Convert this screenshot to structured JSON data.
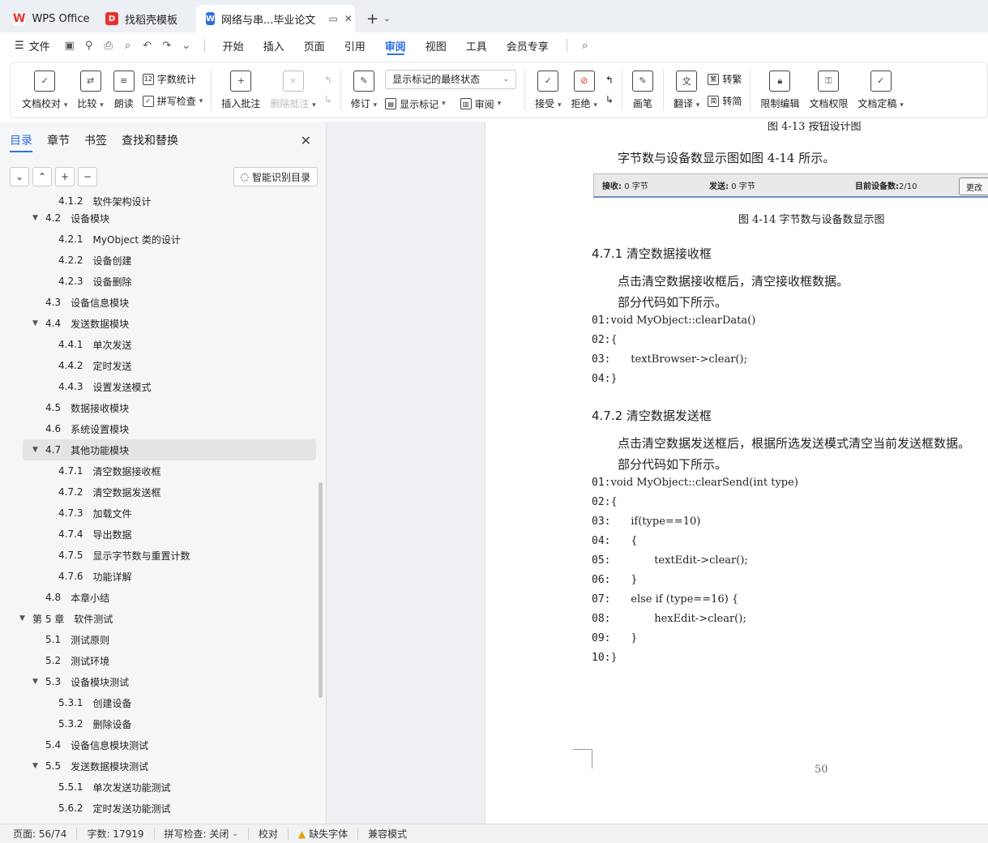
{
  "tabs": [
    {
      "label": "WPS Office"
    },
    {
      "label": "找稻壳模板"
    },
    {
      "label": "网络与串...毕业论文"
    }
  ],
  "menubar": {
    "file": "文件",
    "items": [
      "开始",
      "插入",
      "页面",
      "引用",
      "审阅",
      "视图",
      "工具",
      "会员专享"
    ],
    "active": "审阅"
  },
  "ribbon": {
    "doc_proof": "文档校对",
    "compare": "比较",
    "read_aloud": "朗读",
    "word_count": "字数统计",
    "spell_check": "拼写检查",
    "insert_comment": "插入批注",
    "delete_comment": "删除批注",
    "revise": "修订",
    "markup_state": "显示标记的最终状态",
    "show_markup": "显示标记",
    "review": "审阅",
    "accept": "接受",
    "reject": "拒绝",
    "pen": "画笔",
    "translate": "翻译",
    "to_traditional": "转繁",
    "to_simplified": "转简",
    "restrict_edit": "限制编辑",
    "doc_permission": "文档权限",
    "finalize": "文档定稿"
  },
  "panel": {
    "tabs": [
      "目录",
      "章节",
      "书签",
      "查找和替换"
    ],
    "smart_toc": "智能识别目录",
    "toc": [
      {
        "num": "4.1.2",
        "label": "软件架构设计",
        "level": 3,
        "arrow": ""
      },
      {
        "num": "4.2",
        "label": "设备模块",
        "level": 2,
        "arrow": "▼"
      },
      {
        "num": "4.2.1",
        "label": "MyObject 类的设计",
        "level": 3,
        "arrow": ""
      },
      {
        "num": "4.2.2",
        "label": "设备创建",
        "level": 3,
        "arrow": ""
      },
      {
        "num": "4.2.3",
        "label": "设备删除",
        "level": 3,
        "arrow": ""
      },
      {
        "num": "4.3",
        "label": "设备信息模块",
        "level": 2,
        "arrow": ""
      },
      {
        "num": "4.4",
        "label": "发送数据模块",
        "level": 2,
        "arrow": "▼"
      },
      {
        "num": "4.4.1",
        "label": "单次发送",
        "level": 3,
        "arrow": ""
      },
      {
        "num": "4.4.2",
        "label": "定时发送",
        "level": 3,
        "arrow": ""
      },
      {
        "num": "4.4.3",
        "label": "设置发送模式",
        "level": 3,
        "arrow": ""
      },
      {
        "num": "4.5",
        "label": "数据接收模块",
        "level": 2,
        "arrow": ""
      },
      {
        "num": "4.6",
        "label": "系统设置模块",
        "level": 2,
        "arrow": ""
      },
      {
        "num": "4.7",
        "label": "其他功能模块",
        "level": 2,
        "arrow": "▼",
        "selected": true
      },
      {
        "num": "4.7.1",
        "label": "清空数据接收框",
        "level": 3,
        "arrow": ""
      },
      {
        "num": "4.7.2",
        "label": "清空数据发送框",
        "level": 3,
        "arrow": ""
      },
      {
        "num": "4.7.3",
        "label": "加载文件",
        "level": 3,
        "arrow": ""
      },
      {
        "num": "4.7.4",
        "label": "导出数据",
        "level": 3,
        "arrow": ""
      },
      {
        "num": "4.7.5",
        "label": "显示字节数与重置计数",
        "level": 3,
        "arrow": ""
      },
      {
        "num": "4.7.6",
        "label": "功能详解",
        "level": 3,
        "arrow": ""
      },
      {
        "num": "4.8",
        "label": "本章小结",
        "level": 2,
        "arrow": ""
      },
      {
        "num": "第 5 章",
        "label": "软件测试",
        "level": 1,
        "arrow": "▼"
      },
      {
        "num": "5.1",
        "label": "测试原则",
        "level": 2,
        "arrow": ""
      },
      {
        "num": "5.2",
        "label": "测试环境",
        "level": 2,
        "arrow": ""
      },
      {
        "num": "5.3",
        "label": "设备模块测试",
        "level": 2,
        "arrow": "▼"
      },
      {
        "num": "5.3.1",
        "label": "创建设备",
        "level": 3,
        "arrow": ""
      },
      {
        "num": "5.3.2",
        "label": "删除设备",
        "level": 3,
        "arrow": ""
      },
      {
        "num": "5.4",
        "label": "设备信息模块测试",
        "level": 2,
        "arrow": ""
      },
      {
        "num": "5.5",
        "label": "发送数据模块测试",
        "level": 2,
        "arrow": "▼"
      },
      {
        "num": "5.5.1",
        "label": "单次发送功能测试",
        "level": 3,
        "arrow": ""
      },
      {
        "num": "5.6.2",
        "label": "定时发送功能测试",
        "level": 3,
        "arrow": ""
      }
    ]
  },
  "doc": {
    "fig13_caption": "图 4-13   按钮设计图",
    "p1": "字节数与设备数显示图如图 4-14 所示。",
    "statusfig": {
      "recv_label": "接收:",
      "recv_val": "0 字节",
      "send_label": "发送:",
      "send_val": "0 字节",
      "dev_label": "目前设备数:",
      "dev_val": "2/10",
      "btn": "更改"
    },
    "fig14_caption": "图 4-14   字节数与设备数显示图",
    "h471": "4.7.1    清空数据接收框",
    "p2": "点击清空数据接收框后，清空接收框数据。",
    "p3": "部分代码如下所示。",
    "code1": [
      {
        "ln": "01:",
        "code": "void MyObject::clearData()"
      },
      {
        "ln": "02:",
        "code": "{"
      },
      {
        "ln": "03:",
        "code": "      textBrowser->clear();"
      },
      {
        "ln": "04:",
        "code": "}"
      }
    ],
    "h472": "4.7.2    清空数据发送框",
    "p4": "点击清空数据发送框后，根据所选发送模式清空当前发送框数据。",
    "p5": "部分代码如下所示。",
    "code2": [
      {
        "ln": "01:",
        "code": "void MyObject::clearSend(int type)"
      },
      {
        "ln": "02:",
        "code": "{"
      },
      {
        "ln": "03:",
        "code": "      if(type==10)"
      },
      {
        "ln": "04:",
        "code": "      {"
      },
      {
        "ln": "05:",
        "code": "             textEdit->clear();"
      },
      {
        "ln": "06:",
        "code": "      }"
      },
      {
        "ln": "07:",
        "code": "      else if (type==16) {"
      },
      {
        "ln": "08:",
        "code": "             hexEdit->clear();"
      },
      {
        "ln": "09:",
        "code": "      }"
      },
      {
        "ln": "10:",
        "code": "}"
      }
    ],
    "page_number": "50"
  },
  "statusbar": {
    "page": "页面: 56/74",
    "words": "字数: 17919",
    "spell": "拼写检查: 关闭",
    "proof": "校对",
    "missing_font": "缺失字体",
    "compat": "兼容模式"
  },
  "colors": {
    "accent": "#2f6fe4",
    "wps_red": "#e8312c"
  }
}
